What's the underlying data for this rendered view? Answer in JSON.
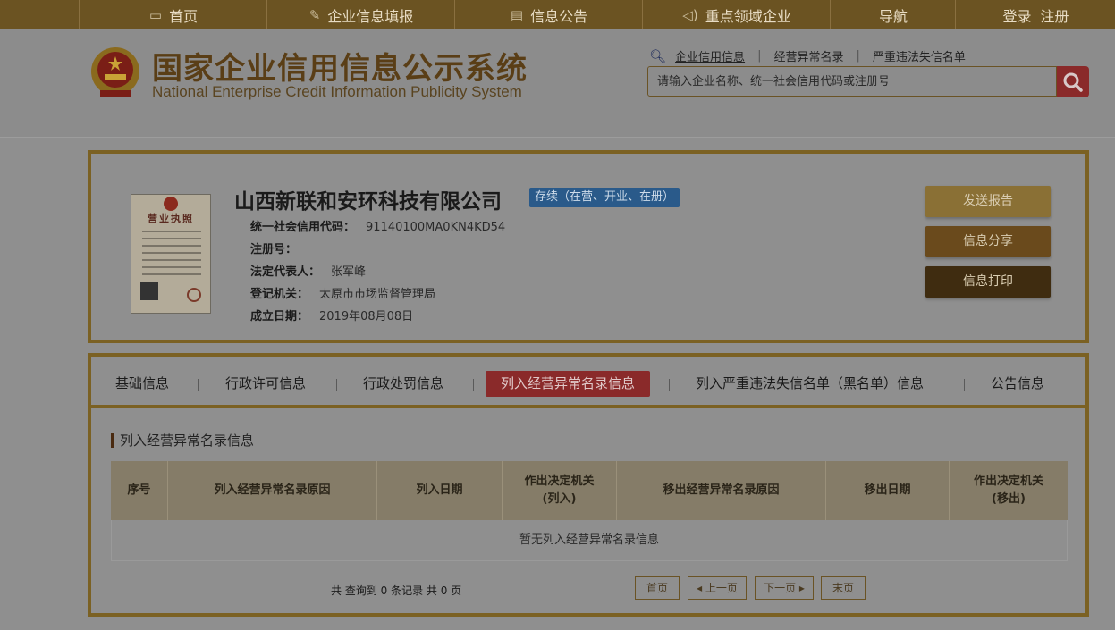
{
  "topnav": {
    "items": [
      {
        "label": "首页",
        "icon": "monitor-icon"
      },
      {
        "label": "企业信息填报",
        "icon": "edit-icon"
      },
      {
        "label": "信息公告",
        "icon": "document-icon"
      },
      {
        "label": "重点领域企业",
        "icon": "speaker-icon"
      },
      {
        "label": "导航",
        "icon": ""
      }
    ],
    "login": "登录",
    "register": "注册"
  },
  "header": {
    "title": "国家企业信用信息公示系统",
    "subtitle": "National Enterprise Credit Information Publicity System",
    "quick_links": [
      "企业信用信息",
      "经营异常名录",
      "严重违法失信名单"
    ],
    "search_placeholder": "请输入企业名称、统一社会信用代码或注册号"
  },
  "company": {
    "name": "山西新联和安环科技有限公司",
    "status": "存续（在营、开业、在册）",
    "license_title": "营业执照",
    "fields": [
      {
        "label": "统一社会信用代码：",
        "value": "91140100MA0KN4KD54"
      },
      {
        "label": "注册号：",
        "value": ""
      },
      {
        "label": "法定代表人：",
        "value": "张军峰"
      },
      {
        "label": "登记机关：",
        "value": "太原市市场监督管理局"
      },
      {
        "label": "成立日期：",
        "value": "2019年08月08日"
      }
    ],
    "actions": [
      "发送报告",
      "信息分享",
      "信息打印"
    ]
  },
  "tabs": [
    "基础信息",
    "行政许可信息",
    "行政处罚信息",
    "列入经营异常名录信息",
    "列入严重违法失信名单（黑名单）信息",
    "公告信息"
  ],
  "section": {
    "title": "列入经营异常名录信息",
    "columns": [
      "序号",
      "列入经营异常名录原因",
      "列入日期",
      "作出决定机关\n(列入)",
      "移出经营异常名录原因",
      "移出日期",
      "作出决定机关\n(移出)"
    ],
    "empty": "暂无列入经营异常名录信息",
    "pager_info": "共 查询到 0 条记录 共 0 页",
    "pager": [
      "首页",
      "◂ 上一页",
      "下一页 ▸",
      "末页"
    ]
  },
  "colors": {
    "nav_bg": "#6b5322",
    "border_gold": "#7b6123",
    "active_tab": "#8a2a2a",
    "badge_blue": "#2a5a8a"
  }
}
